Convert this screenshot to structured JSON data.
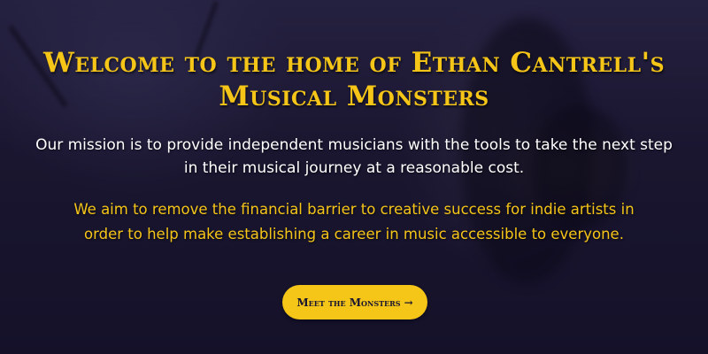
{
  "hero": {
    "title": "Welcome to the home of Ethan Cantrell's Musical Monsters",
    "mission": "Our mission is to provide independent musicians with the tools to take the next step in their musical journey at a reasonable cost.",
    "aim": "We aim to remove the financial barrier to creative success for indie artists in order to help make establishing a career in music accessible to everyone.",
    "cta": {
      "label": "Meet the Monsters",
      "arrow": "→"
    }
  },
  "colors": {
    "accent": "#f5c518",
    "background": "#1a1630",
    "text": "#ffffff"
  }
}
